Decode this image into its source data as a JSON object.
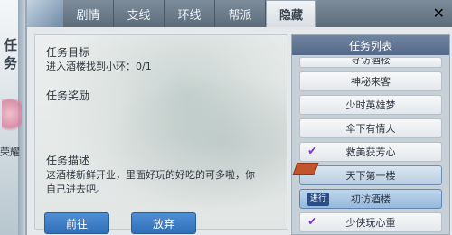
{
  "backdrop": {
    "vertical_text": "任务",
    "snippet": "荣耀"
  },
  "tabs": [
    {
      "label": "剧情",
      "active": false
    },
    {
      "label": "支线",
      "active": false
    },
    {
      "label": "环线",
      "active": false
    },
    {
      "label": "帮派",
      "active": false
    },
    {
      "label": "隐藏",
      "active": true
    }
  ],
  "detail": {
    "goal_label": "任务目标",
    "goal_text": "进入酒楼找到小环：0/1",
    "reward_label": "任务奖励",
    "desc_label": "任务描述",
    "desc_text_line1": "这酒楼新鲜开业，里面好玩的好吃的可多啦，你",
    "desc_text_line2": "自己进去吧。",
    "go_button": "前往",
    "abandon_button": "放弃"
  },
  "task_list": {
    "title": "任务列表",
    "items": [
      {
        "label": "寻访酒楼",
        "state": "cut",
        "check": true,
        "badge": ""
      },
      {
        "label": "神秘来客",
        "state": "normal",
        "check": false,
        "badge": ""
      },
      {
        "label": "少时英雄梦",
        "state": "normal",
        "check": false,
        "badge": ""
      },
      {
        "label": "伞下有情人",
        "state": "normal",
        "check": false,
        "badge": ""
      },
      {
        "label": "救美获芳心",
        "state": "normal",
        "check": true,
        "badge": ""
      },
      {
        "label": "天下第一楼",
        "state": "selected",
        "check": false,
        "badge": ""
      },
      {
        "label": "初访酒楼",
        "state": "active",
        "check": false,
        "badge": "进行"
      },
      {
        "label": "少侠玩心重",
        "state": "normal",
        "check": true,
        "badge": ""
      }
    ]
  },
  "colors": {
    "tab_bar": "#5d6c7a",
    "button": "#2f6fb8",
    "list_header": "#54698a",
    "check": "#7a3fc0"
  }
}
